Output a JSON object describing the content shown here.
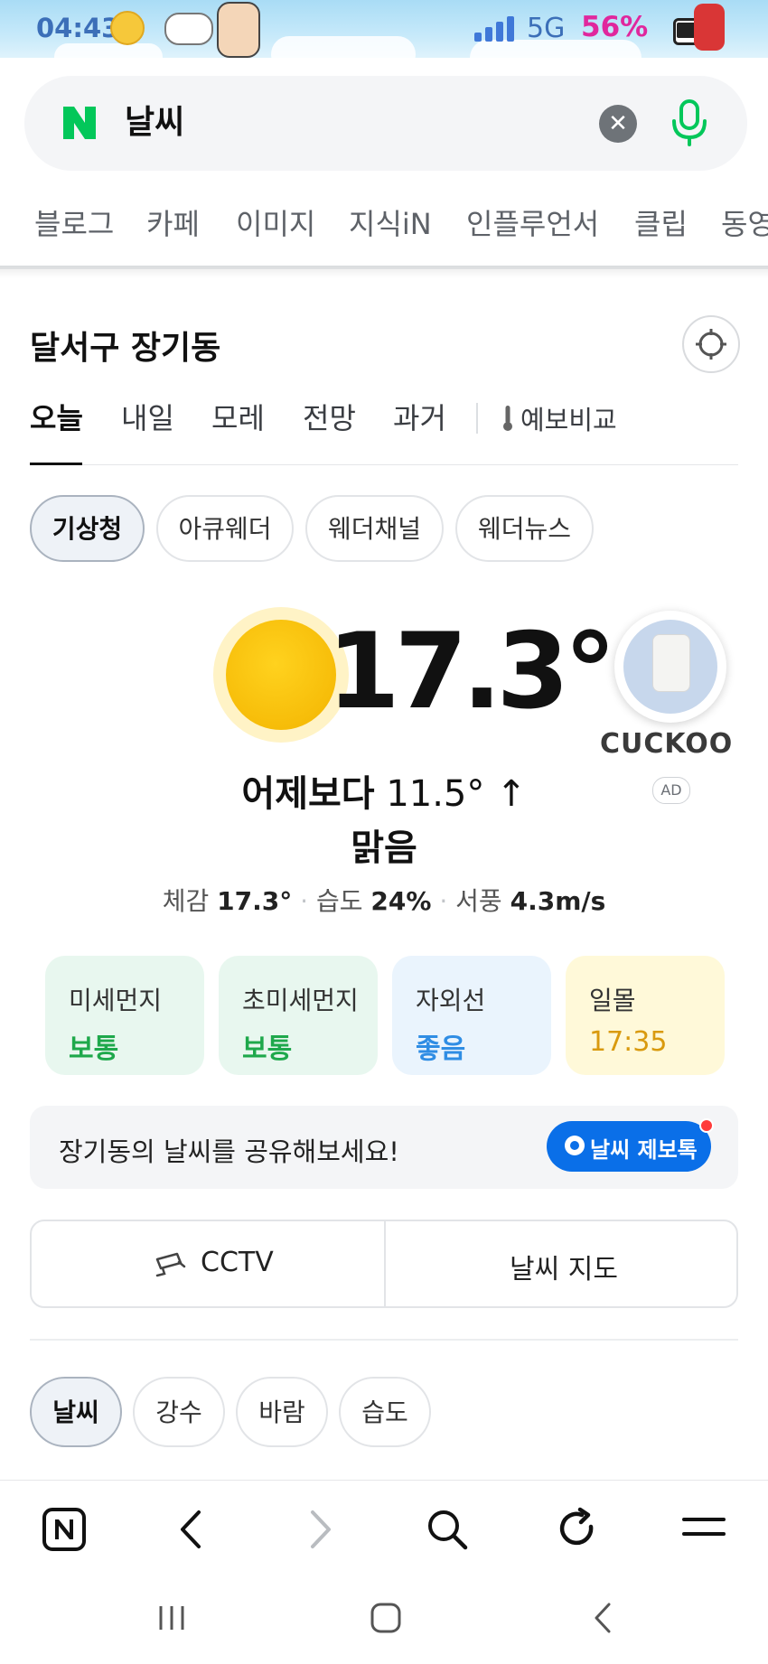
{
  "status_bar": {
    "time": "04:43",
    "network": "5G",
    "battery": "56%"
  },
  "search": {
    "query": "날씨",
    "clear_icon": "close-icon",
    "mic_icon": "microphone-icon"
  },
  "search_tabs": [
    "블로그",
    "카페",
    "이미지",
    "지식iN",
    "인플루언서",
    "클립",
    "동영"
  ],
  "location": {
    "name": "달서구 장기동",
    "gps_icon": "crosshair-icon"
  },
  "day_tabs": [
    "오늘",
    "내일",
    "모레",
    "전망",
    "과거"
  ],
  "forecast_compare_label": "예보비교",
  "providers": [
    "기상청",
    "아큐웨더",
    "웨더채널",
    "웨더뉴스"
  ],
  "weather": {
    "temperature": "17.3°",
    "compare_prefix": "어제보다",
    "compare_value": "11.5° ↑",
    "condition": "맑음",
    "feels_label": "체감",
    "feels_value": "17.3°",
    "humidity_label": "습도",
    "humidity_value": "24%",
    "wind_label": "서풍",
    "wind_value": "4.3m/s"
  },
  "ad": {
    "brand": "CUCKOO",
    "tag": "AD"
  },
  "cards": [
    {
      "label": "미세먼지",
      "value": "보통",
      "bg": "#e8f7ef",
      "color": "#1ea84b"
    },
    {
      "label": "초미세먼지",
      "value": "보통",
      "bg": "#e8f7ef",
      "color": "#1ea84b"
    },
    {
      "label": "자외선",
      "value": "좋음",
      "bg": "#eaf4fd",
      "color": "#2f8de4"
    },
    {
      "label": "일몰",
      "value": "17:35",
      "bg": "#fff9d9",
      "color": "#d99a0e"
    }
  ],
  "share": {
    "text": "장기동의 날씨를 공유해보세요!",
    "button": "날씨 제보톡"
  },
  "buttons": {
    "cctv": "CCTV",
    "map": "날씨 지도"
  },
  "filter_tabs": [
    "날씨",
    "강수",
    "바람",
    "습도"
  ],
  "colors": {
    "accent_blue": "#0a6fe8",
    "naver_green": "#03c75a",
    "sun": "#f3b400"
  }
}
